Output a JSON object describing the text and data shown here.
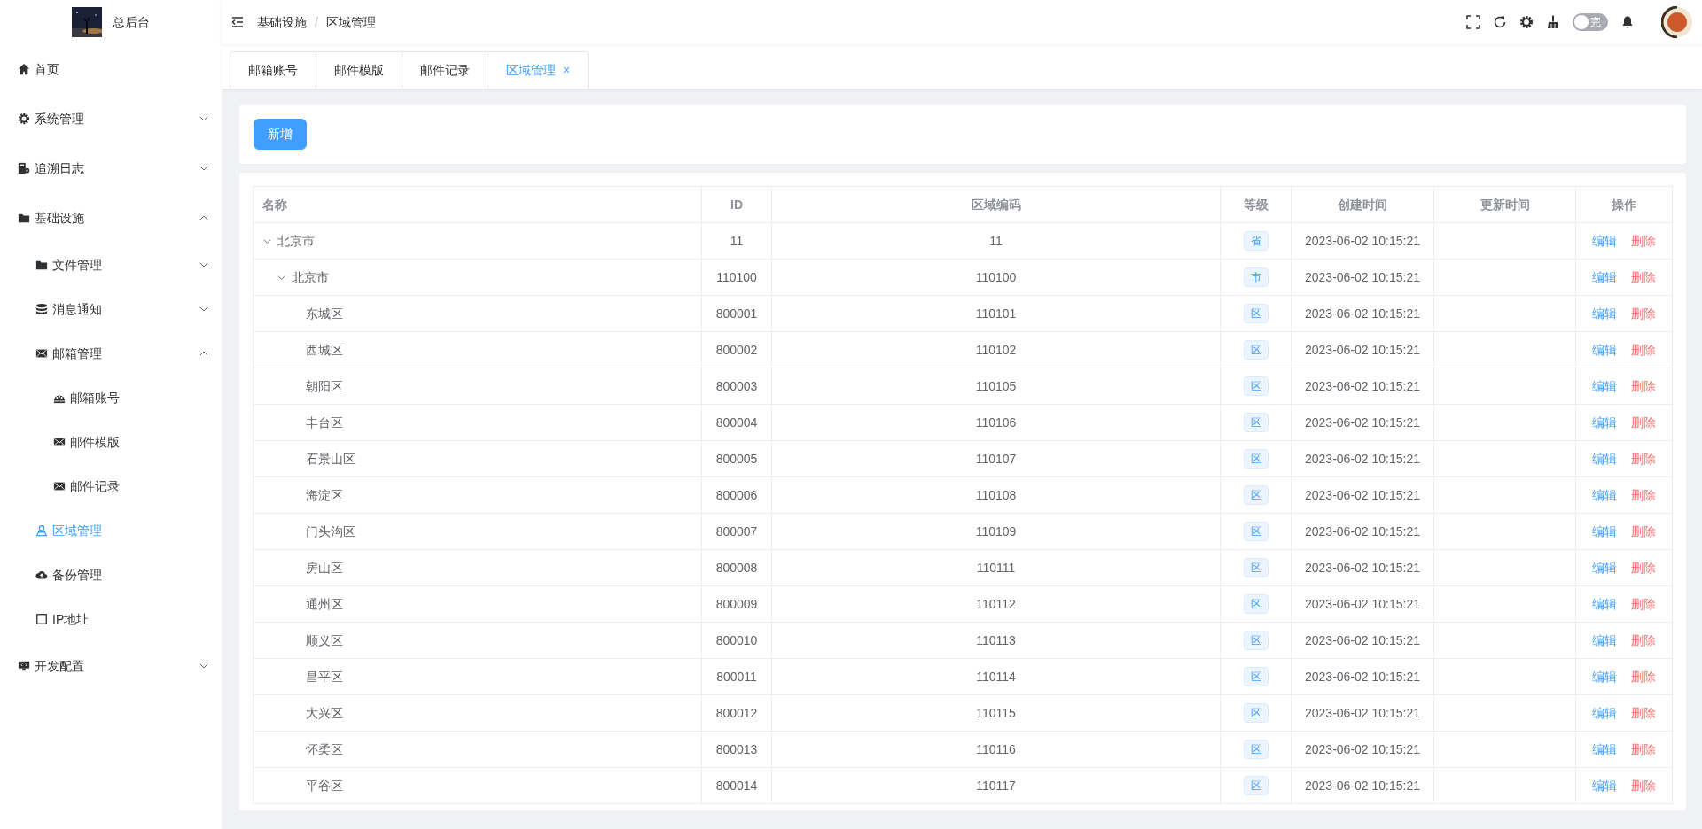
{
  "app": {
    "title": "总后台"
  },
  "breadcrumb": [
    "基础设施",
    "区域管理"
  ],
  "breadcrumb_separator": "/",
  "toggle": {
    "label": "完",
    "on": false
  },
  "sidebar": {
    "items": [
      {
        "label": "首页",
        "selected": false
      },
      {
        "label": "系统管理",
        "expanded": false,
        "selected": false
      },
      {
        "label": "追溯日志",
        "expanded": false,
        "selected": false
      },
      {
        "label": "基础设施",
        "expanded": true,
        "selected": false,
        "children": [
          {
            "label": "文件管理",
            "expanded": false,
            "selected": false
          },
          {
            "label": "消息通知",
            "expanded": false,
            "selected": false
          },
          {
            "label": "邮箱管理",
            "expanded": true,
            "selected": false,
            "children": [
              {
                "label": "邮箱账号",
                "selected": false
              },
              {
                "label": "邮件模版",
                "selected": false
              },
              {
                "label": "邮件记录",
                "selected": false
              }
            ]
          },
          {
            "label": "区域管理",
            "selected": true
          },
          {
            "label": "备份管理",
            "selected": false
          },
          {
            "label": "IP地址",
            "selected": false
          }
        ]
      },
      {
        "label": "开发配置",
        "expanded": false,
        "selected": false
      }
    ]
  },
  "tabs": [
    {
      "label": "邮箱账号",
      "selected": false
    },
    {
      "label": "邮件模版",
      "selected": false
    },
    {
      "label": "邮件记录",
      "selected": false
    },
    {
      "label": "区域管理",
      "selected": true,
      "close": "×"
    }
  ],
  "add_button": "新增",
  "table": {
    "columns": [
      "名称",
      "ID",
      "区域编码",
      "等级",
      "创建时间",
      "更新时间",
      "操作"
    ],
    "rows": [
      {
        "name": "北京市",
        "id": "11",
        "code": "11",
        "level": "省",
        "created": "2023-06-02 10:15:21",
        "actions": [
          "编辑",
          "删除"
        ],
        "expanded": true,
        "children": [
          {
            "name": "北京市",
            "id": "110100",
            "code": "110100",
            "level": "市",
            "created": "2023-06-02 10:15:21",
            "actions": [
              "编辑",
              "删除"
            ],
            "expanded": true,
            "children": [
              {
                "name": "东城区",
                "id": "800001",
                "code": "110101",
                "level": "区",
                "created": "2023-06-02 10:15:21",
                "actions": [
                  "编辑",
                  "删除"
                ]
              },
              {
                "name": "西城区",
                "id": "800002",
                "code": "110102",
                "level": "区",
                "created": "2023-06-02 10:15:21",
                "actions": [
                  "编辑",
                  "删除"
                ]
              },
              {
                "name": "朝阳区",
                "id": "800003",
                "code": "110105",
                "level": "区",
                "created": "2023-06-02 10:15:21",
                "actions": [
                  "编辑",
                  "删除"
                ]
              },
              {
                "name": "丰台区",
                "id": "800004",
                "code": "110106",
                "level": "区",
                "created": "2023-06-02 10:15:21",
                "actions": [
                  "编辑",
                  "删除"
                ]
              },
              {
                "name": "石景山区",
                "id": "800005",
                "code": "110107",
                "level": "区",
                "created": "2023-06-02 10:15:21",
                "actions": [
                  "编辑",
                  "删除"
                ]
              },
              {
                "name": "海淀区",
                "id": "800006",
                "code": "110108",
                "level": "区",
                "created": "2023-06-02 10:15:21",
                "actions": [
                  "编辑",
                  "删除"
                ]
              },
              {
                "name": "门头沟区",
                "id": "800007",
                "code": "110109",
                "level": "区",
                "created": "2023-06-02 10:15:21",
                "actions": [
                  "编辑",
                  "删除"
                ]
              },
              {
                "name": "房山区",
                "id": "800008",
                "code": "110111",
                "level": "区",
                "created": "2023-06-02 10:15:21",
                "actions": [
                  "编辑",
                  "删除"
                ]
              },
              {
                "name": "通州区",
                "id": "800009",
                "code": "110112",
                "level": "区",
                "created": "2023-06-02 10:15:21",
                "actions": [
                  "编辑",
                  "删除"
                ]
              },
              {
                "name": "顺义区",
                "id": "800010",
                "code": "110113",
                "level": "区",
                "created": "2023-06-02 10:15:21",
                "actions": [
                  "编辑",
                  "删除"
                ]
              },
              {
                "name": "昌平区",
                "id": "800011",
                "code": "110114",
                "level": "区",
                "created": "2023-06-02 10:15:21",
                "actions": [
                  "编辑",
                  "删除"
                ]
              },
              {
                "name": "大兴区",
                "id": "800012",
                "code": "110115",
                "level": "区",
                "created": "2023-06-02 10:15:21",
                "actions": [
                  "编辑",
                  "删除"
                ]
              },
              {
                "name": "怀柔区",
                "id": "800013",
                "code": "110116",
                "level": "区",
                "created": "2023-06-02 10:15:21",
                "actions": [
                  "编辑",
                  "删除"
                ]
              },
              {
                "name": "平谷区",
                "id": "800014",
                "code": "110117",
                "level": "区",
                "created": "2023-06-02 10:15:21",
                "actions": [
                  "编辑",
                  "删除"
                ]
              }
            ]
          }
        ]
      }
    ]
  }
}
